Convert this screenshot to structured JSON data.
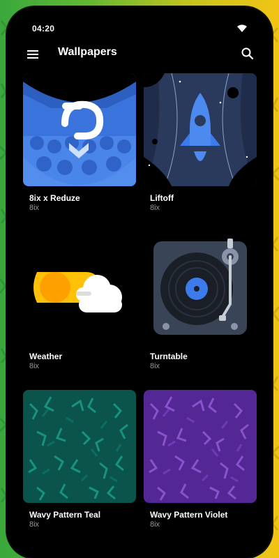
{
  "status": {
    "time": "04:20"
  },
  "appbar": {
    "title": "Wallpapers",
    "menu_icon": "hamburger-menu-icon",
    "search_icon": "search-icon"
  },
  "wallpapers": [
    {
      "title": "8ix x Reduze",
      "author": "8ix"
    },
    {
      "title": "Liftoff",
      "author": "8ix"
    },
    {
      "title": "Weather",
      "author": "8ix"
    },
    {
      "title": "Turntable",
      "author": "8ix"
    },
    {
      "title": "Wavy Pattern Teal",
      "author": "8ix"
    },
    {
      "title": "Wavy Pattern Violet",
      "author": "8ix"
    }
  ],
  "colors": {
    "app_background": "#000000",
    "accent_blue": "#3d7bea",
    "sun_yellow": "#ffc107",
    "teal": "#0c5b53",
    "violet": "#5b2c9c"
  }
}
